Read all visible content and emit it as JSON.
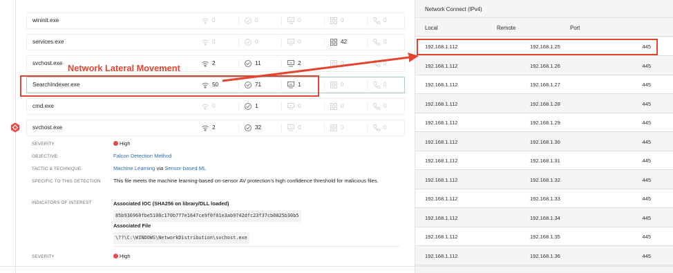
{
  "process_tree": {
    "rows": [
      {
        "name": "wininit.exe",
        "network": "0",
        "dns": "0",
        "disk": "0",
        "modules": "0",
        "registry": "0"
      },
      {
        "name": "services.exe",
        "network": "0",
        "dns": "0",
        "disk": "0",
        "modules": "42",
        "registry": "0"
      },
      {
        "name": "svchost.exe",
        "network": "2",
        "dns": "11",
        "disk": "2",
        "modules": "0",
        "registry": "0"
      },
      {
        "name": "SearchIndexer.exe",
        "network": "50",
        "dns": "71",
        "disk": "1",
        "modules": "0",
        "registry": "0"
      },
      {
        "name": "cmd.exe",
        "network": "0",
        "dns": "1",
        "disk": "0",
        "modules": "0",
        "registry": "0"
      },
      {
        "name": "svchost.exe",
        "network": "2",
        "dns": "32",
        "disk": "0",
        "modules": "0",
        "registry": "0"
      }
    ]
  },
  "annotation": {
    "label": "Network Lateral Movement",
    "color": "#e4442f"
  },
  "detection": {
    "severity_label": "SEVERITY",
    "severity_value": "High",
    "objective_label": "OBJECTIVE",
    "objective_value": "Falcon Detection Method",
    "tactic_label": "TACTIC & TECHNIQUE",
    "tactic_value": "Machine Learning",
    "tactic_via": "via",
    "technique_value": "Sensor-based ML",
    "specific_label": "SPECIFIC TO THIS DETECTION",
    "specific_value": "This file meets the machine learning-based on-sensor AV protection's high confidence threshold for malicious files.",
    "ioi_label": "INDICATORS OF INTEREST",
    "ioc_title": "Associated IOC (SHA256 on library/DLL loaded)",
    "ioc_hash": "85b936960fbe5100c170b777e1647ce9f0f01e3ab9742dfc23f37cb0825b30b5",
    "file_title": "Associated File",
    "file_path": "\\??\\C:\\WINDOWS\\NetworkDistribution\\svchost.exe",
    "severity2_label": "SEVERITY",
    "severity2_value": "High",
    "severity_color": "#e0504a",
    "link_color": "#2a6fb0"
  },
  "network_panel": {
    "title": "Network Connect (IPv4)",
    "columns": {
      "local": "Local",
      "remote": "Remote",
      "port": "Port"
    },
    "rows": [
      {
        "local": "192.168.1.112",
        "remote": "192.168.1.25",
        "port": "445"
      },
      {
        "local": "192.168.1.112",
        "remote": "192.168.1.26",
        "port": "445"
      },
      {
        "local": "192.168.1.112",
        "remote": "192.168.1.27",
        "port": "445"
      },
      {
        "local": "192.168.1.112",
        "remote": "192.168.1.28",
        "port": "445"
      },
      {
        "local": "192.168.1.112",
        "remote": "192.168.1.29",
        "port": "445"
      },
      {
        "local": "192.168.1.112",
        "remote": "192.168.1.30",
        "port": "445"
      },
      {
        "local": "192.168.1.112",
        "remote": "192.168.1.31",
        "port": "445"
      },
      {
        "local": "192.168.1.112",
        "remote": "192.168.1.32",
        "port": "445"
      },
      {
        "local": "192.168.1.112",
        "remote": "192.168.1.33",
        "port": "445"
      },
      {
        "local": "192.168.1.112",
        "remote": "192.168.1.34",
        "port": "445"
      },
      {
        "local": "192.168.1.112",
        "remote": "192.168.1.35",
        "port": "445"
      },
      {
        "local": "192.168.1.112",
        "remote": "192.168.1.36",
        "port": "445"
      }
    ]
  },
  "icons": {
    "network": "wifi-icon",
    "dns": "dns-icon",
    "disk": "disk-icon",
    "modules": "modules-icon",
    "registry": "registry-icon",
    "detection": "detection-badge-icon"
  }
}
